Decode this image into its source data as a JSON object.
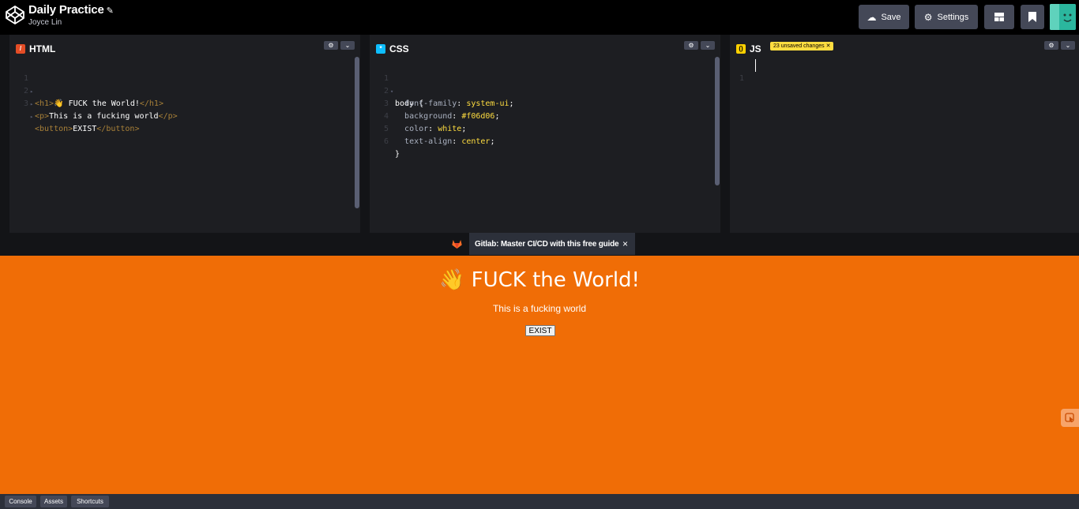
{
  "header": {
    "title": "Daily Practice",
    "author": "Joyce Lin",
    "save_label": "Save",
    "settings_label": "Settings"
  },
  "editors": {
    "html": {
      "name": "HTML",
      "lines": [
        {
          "num": "1",
          "open": "<h1>",
          "text": "👋 FUCK the World!",
          "close": "</h1>"
        },
        {
          "num": "2",
          "open": "<p>",
          "text": "This is a fucking world",
          "close": "</p>"
        },
        {
          "num": "3",
          "open": "<button>",
          "text": "EXIST",
          "close": "</button>"
        }
      ]
    },
    "css": {
      "name": "CSS",
      "lines": [
        {
          "num": "1",
          "selector": "body",
          "brace": " {"
        },
        {
          "num": "2",
          "prop": "font-family",
          "value": "system-ui"
        },
        {
          "num": "3",
          "prop": "background",
          "value": "#f06d06"
        },
        {
          "num": "4",
          "prop": "color",
          "value": "white"
        },
        {
          "num": "5",
          "prop": "text-align",
          "value": "center"
        },
        {
          "num": "6",
          "brace": "}"
        }
      ]
    },
    "js": {
      "name": "JS",
      "badge": "23 unsaved changes",
      "lines": [
        {
          "num": "1"
        }
      ]
    }
  },
  "ad": {
    "text": "Gitlab: Master CI/CD with this free guide",
    "close": "×"
  },
  "preview": {
    "h1": "👋 FUCK the World!",
    "p": "This is a fucking world",
    "button": "EXIST",
    "background": "#f06d06"
  },
  "footer": {
    "console": "Console",
    "assets": "Assets",
    "shortcuts": "Shortcuts"
  },
  "colors": {
    "header_bg": "#000000",
    "editor_bg": "#1d1e22",
    "button_bg": "#444857",
    "badge_yellow": "#ffdd40",
    "html_icon": "#e44d26",
    "css_icon": "#0ebeff",
    "js_icon": "#fcd000"
  }
}
